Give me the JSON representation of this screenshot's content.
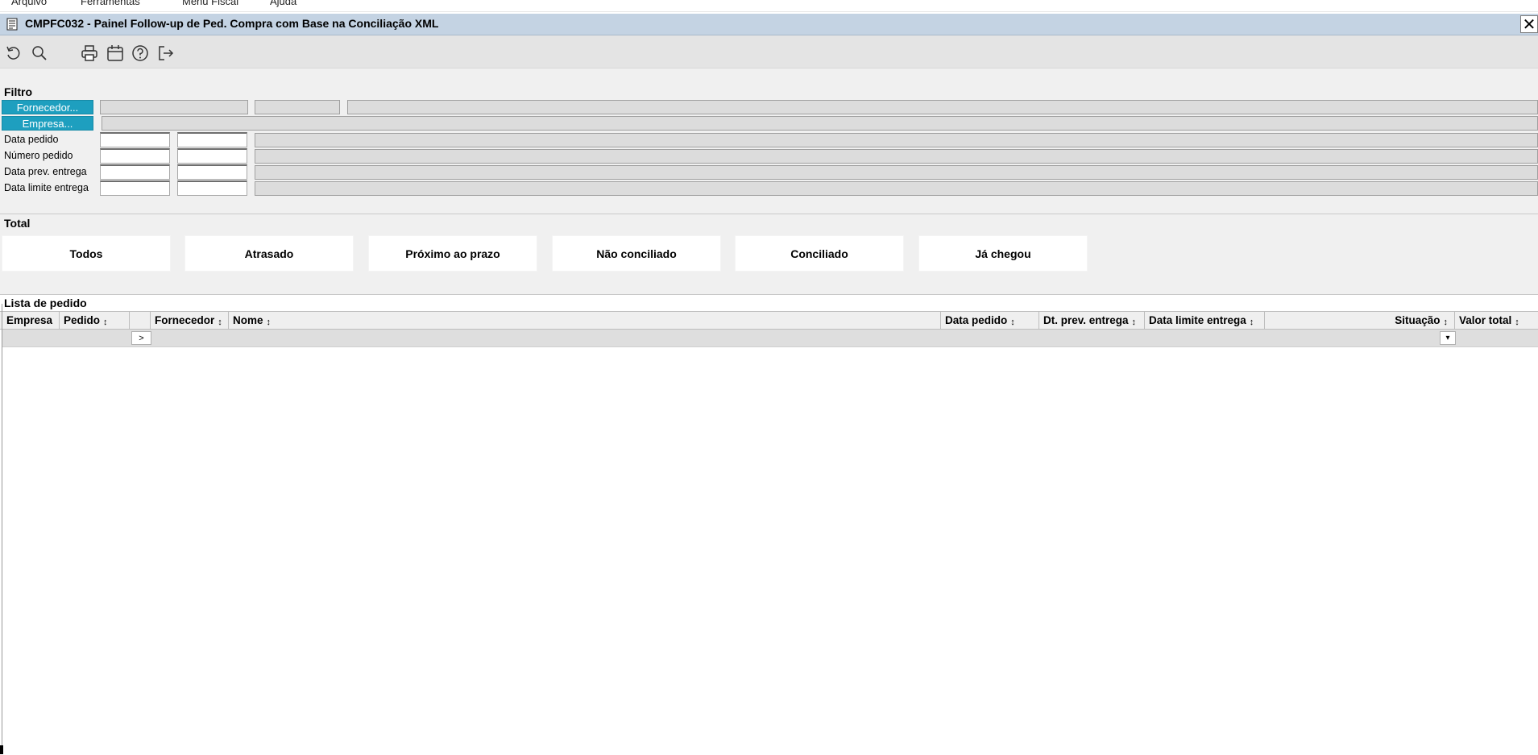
{
  "menubar": {
    "items": [
      {
        "label": "Arquivo"
      },
      {
        "label": "Ferramentas"
      },
      {
        "label": "Menu Fiscal"
      },
      {
        "label": "Ajuda"
      }
    ]
  },
  "window": {
    "title": "CMPFC032 - Painel Follow-up de Ped. Compra com Base na Conciliação XML",
    "close_label": "✕"
  },
  "toolbar": {
    "icons": [
      "refresh-icon",
      "search-icon",
      "printer-icon",
      "calendar-icon",
      "help-icon",
      "exit-icon"
    ]
  },
  "filter": {
    "title": "Filtro",
    "fornecedor_button": "Fornecedor...",
    "empresa_button": "Empresa...",
    "fields": [
      {
        "label": "Data pedido"
      },
      {
        "label": "Número pedido"
      },
      {
        "label": "Data prev. entrega"
      },
      {
        "label": "Data limite entrega"
      }
    ]
  },
  "total": {
    "title": "Total",
    "cards": [
      "Todos",
      "Atrasado",
      "Próximo ao prazo",
      "Não conciliado",
      "Conciliado",
      "Já chegou"
    ]
  },
  "list": {
    "title": "Lista de pedido",
    "columns": [
      {
        "label": "Empresa",
        "sortable": false
      },
      {
        "label": "Pedido",
        "sortable": true
      },
      {
        "label": "",
        "sortable": false
      },
      {
        "label": "Fornecedor",
        "sortable": true
      },
      {
        "label": "Nome",
        "sortable": true
      },
      {
        "label": "Data pedido",
        "sortable": true
      },
      {
        "label": "Dt. prev. entrega",
        "sortable": true
      },
      {
        "label": "Data limite entrega",
        "sortable": true
      },
      {
        "label": "Situação",
        "sortable": true
      },
      {
        "label": "Valor total",
        "sortable": true
      }
    ],
    "row_cursor": ">",
    "row_dropdown": "▾"
  }
}
